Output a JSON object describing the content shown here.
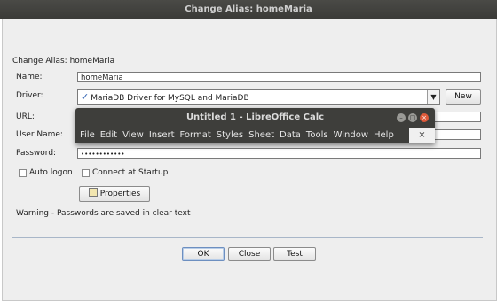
{
  "window": {
    "title": "Change Alias: homeMaria"
  },
  "dialog": {
    "heading": "Change Alias: homeMaria",
    "name_label": "Name:",
    "name_value": "homeMaria",
    "driver_label": "Driver:",
    "driver_value": "MariaDB Driver for MySQL and MariaDB",
    "driver_check_icon": "✓",
    "new_button": "New",
    "url_label": "URL:",
    "user_label": "User Name:",
    "password_label": "Password:",
    "password_value": "••••••••••••",
    "auto_logon": "Auto logon",
    "connect_startup": "Connect at Startup",
    "properties_button": "Properties",
    "warning": "Warning - Passwords are saved in clear text",
    "ok_button": "OK",
    "close_button": "Close",
    "test_button": "Test"
  },
  "libreoffice": {
    "title": "Untitled 1 - LibreOffice Calc",
    "menu": [
      "File",
      "Edit",
      "View",
      "Insert",
      "Format",
      "Styles",
      "Sheet",
      "Data",
      "Tools",
      "Window",
      "Help"
    ],
    "close_doc": "×"
  }
}
